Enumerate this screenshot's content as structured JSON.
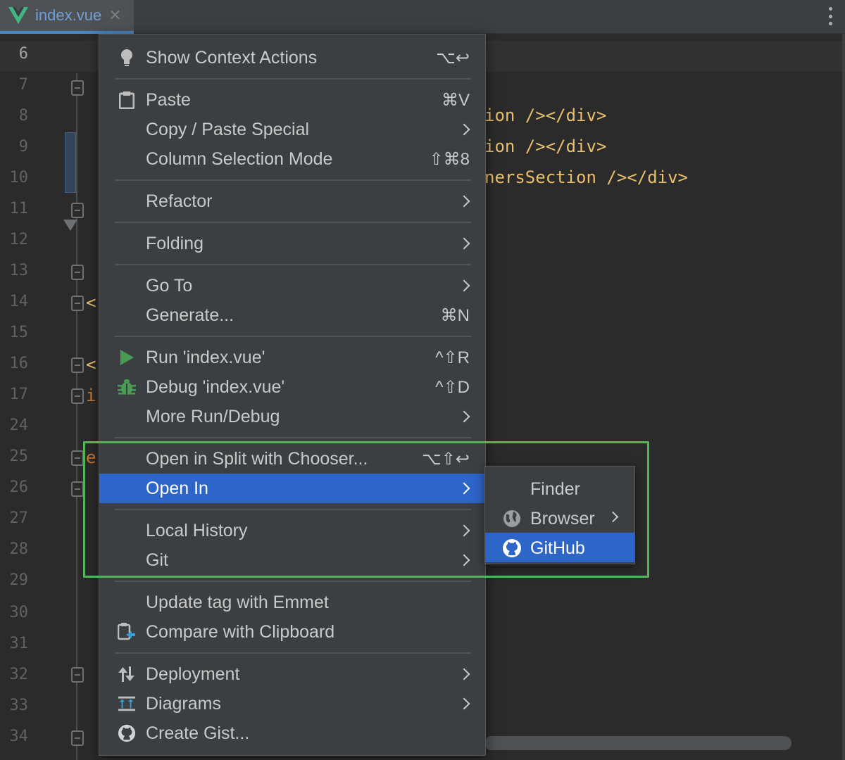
{
  "tab": {
    "filename": "index.vue",
    "close_glyph": "✕"
  },
  "gutter": {
    "current_line": "6",
    "line_numbers": [
      "6",
      "7",
      "8",
      "9",
      "10",
      "11",
      "12",
      "13",
      "14",
      "15",
      "16",
      "17",
      "24",
      "25",
      "26",
      "27",
      "28",
      "29",
      "30",
      "31",
      "32",
      "33",
      "34"
    ]
  },
  "code": {
    "line8": "ion /></div>",
    "line9": "ion /></div>",
    "line10": "nersSection /></div>",
    "line14": "<",
    "line16": "<",
    "line17": "i",
    "line25": "e"
  },
  "menu": {
    "show_context_actions": {
      "label": "Show Context Actions",
      "shortcut": "⌥↩"
    },
    "paste": {
      "label": "Paste",
      "shortcut": "⌘V"
    },
    "copy_paste_special": {
      "label": "Copy / Paste Special"
    },
    "column_selection_mode": {
      "label": "Column Selection Mode",
      "shortcut": "⇧⌘8"
    },
    "refactor": {
      "label": "Refactor"
    },
    "folding": {
      "label": "Folding"
    },
    "go_to": {
      "label": "Go To"
    },
    "generate": {
      "label": "Generate...",
      "shortcut": "⌘N"
    },
    "run": {
      "label": "Run 'index.vue'",
      "shortcut": "^⇧R"
    },
    "debug": {
      "label": "Debug 'index.vue'",
      "shortcut": "^⇧D"
    },
    "more_run_debug": {
      "label": "More Run/Debug"
    },
    "open_in_split": {
      "label": "Open in Split with Chooser...",
      "shortcut": "⌥⇧↩"
    },
    "open_in": {
      "label": "Open In"
    },
    "local_history": {
      "label": "Local History"
    },
    "git": {
      "label": "Git"
    },
    "update_tag": {
      "label": "Update tag with Emmet"
    },
    "compare_clipboard": {
      "label": "Compare with Clipboard"
    },
    "deployment": {
      "label": "Deployment"
    },
    "diagrams": {
      "label": "Diagrams"
    },
    "create_gist": {
      "label": "Create Gist..."
    }
  },
  "submenu": {
    "finder": "Finder",
    "browser": "Browser",
    "github": "GitHub"
  },
  "colors": {
    "selection": "#2d65c8",
    "highlight_frame": "#52b457",
    "run_icon": "#499c54",
    "debug_icon": "#499c54"
  },
  "icons": {
    "show_context_actions": "lightbulb-icon",
    "paste": "clipboard-icon",
    "run": "play-icon",
    "debug": "bug-icon",
    "compare_clipboard": "compare-clipboard-icon",
    "deployment": "deployment-arrows-icon",
    "diagrams": "diagram-icon",
    "create_gist": "github-icon",
    "browser": "globe-icon",
    "github": "github-icon"
  }
}
